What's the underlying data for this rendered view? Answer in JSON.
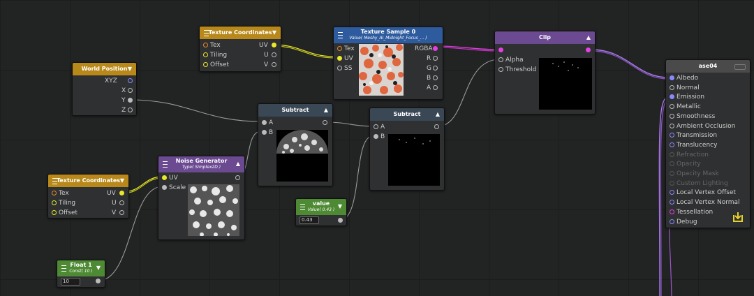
{
  "nodes": {
    "tex_coords_top": {
      "title": "Texture Coordinates",
      "inputs": [
        "Tex",
        "Tiling",
        "Offset"
      ],
      "outputs": [
        "UV",
        "U",
        "V"
      ]
    },
    "texture_sample": {
      "title": "Texture Sample 0",
      "subtitle": "Value( Meshy_AI_Midnight_Focus_... )",
      "inputs": [
        "Tex",
        "UV",
        "SS"
      ],
      "outputs": [
        "RGBA",
        "R",
        "G",
        "B",
        "A"
      ]
    },
    "clip": {
      "title": "Clip",
      "inputs": [
        "Alpha",
        "Threshold"
      ]
    },
    "world_position": {
      "title": "World Position",
      "outputs": [
        "XYZ",
        "X",
        "Y",
        "Z"
      ]
    },
    "subtract_1": {
      "title": "Subtract",
      "inputs": [
        "A",
        "B"
      ]
    },
    "subtract_2": {
      "title": "Subtract",
      "inputs": [
        "A",
        "B"
      ]
    },
    "tex_coords_bottom": {
      "title": "Texture Coordinates",
      "inputs": [
        "Tex",
        "Tiling",
        "Offset"
      ],
      "outputs": [
        "UV",
        "U",
        "V"
      ]
    },
    "noise_generator": {
      "title": "Noise Generator",
      "subtitle": "Type( Simplex2D )",
      "inputs": [
        "UV",
        "Scale"
      ]
    },
    "value_node": {
      "title": "value",
      "subtitle": "Value( 0.43 )",
      "field": "0.43"
    },
    "float_node": {
      "title": "Float 1",
      "subtitle": "Const( 10 )",
      "field": "10"
    },
    "output": {
      "title": "ase04",
      "inputs": [
        "Albedo",
        "Normal",
        "Emission",
        "Metallic",
        "Smoothness",
        "Ambient Occlusion",
        "Transmission",
        "Translucency",
        "Refraction",
        "Opacity",
        "Opacity Mask",
        "Custom Lighting",
        "Local Vertex Offset",
        "Local Vertex Normal",
        "Tessellation",
        "Debug"
      ]
    }
  },
  "colors": {
    "uv_wire": "#e9e92a",
    "rgba_wire": "#d93fd9",
    "out_wire": "#9b6fd6",
    "float_wire": "#9a9a9a"
  }
}
